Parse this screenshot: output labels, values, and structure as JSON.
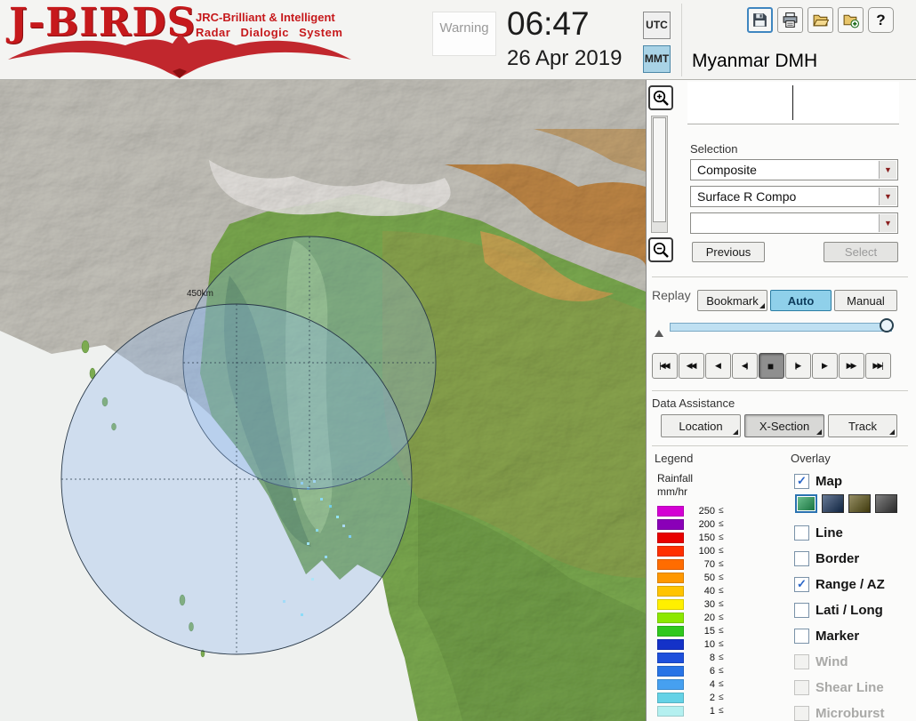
{
  "header": {
    "logo": {
      "title": "J-BIRDS",
      "subtitle_line1": "JRC-Brilliant & Intelligent",
      "subtitle_line2": "Radar Dialogic System"
    },
    "warning_label": "Warning",
    "clock": {
      "time": "06:47",
      "date": "26 Apr 2019"
    },
    "timezone": {
      "utc_label": "UTC",
      "mmt_label": "MMT",
      "selected": "MMT"
    },
    "toolbar_icons": [
      "save-icon",
      "print-icon",
      "open-folder-icon",
      "import-icon",
      "help-icon"
    ],
    "help_glyph": "?",
    "station_title": "Myanmar DMH"
  },
  "map": {
    "range_ring_label": "450km"
  },
  "selection": {
    "label": "Selection",
    "dropdown1_value": "Composite",
    "dropdown2_value": "Surface R Compo",
    "dropdown3_value": "",
    "previous_label": "Previous",
    "select_label": "Select"
  },
  "replay": {
    "label": "Replay",
    "bookmark_label": "Bookmark",
    "auto_label": "Auto",
    "manual_label": "Manual",
    "mode_selected": "Auto",
    "transport_buttons": [
      "|◀◀",
      "◀◀",
      "◀",
      "◀|",
      "■",
      "|▶",
      "▶",
      "▶▶",
      "▶▶|"
    ],
    "transport_active": "■"
  },
  "data_assistance": {
    "label": "Data Assistance",
    "location_label": "Location",
    "xsection_label": "X-Section",
    "track_label": "Track",
    "active": "X-Section"
  },
  "legend": {
    "title": "Legend",
    "unit_line1": "Rainfall",
    "unit_line2": "mm/hr",
    "le_symbol": "≤",
    "rows": [
      {
        "value": "250",
        "color": "#d400d4"
      },
      {
        "value": "200",
        "color": "#8a00b8"
      },
      {
        "value": "150",
        "color": "#e80000"
      },
      {
        "value": "100",
        "color": "#ff3000"
      },
      {
        "value": "70",
        "color": "#ff6c00"
      },
      {
        "value": "50",
        "color": "#ff9800"
      },
      {
        "value": "40",
        "color": "#ffc400"
      },
      {
        "value": "30",
        "color": "#fff000"
      },
      {
        "value": "20",
        "color": "#8ce800"
      },
      {
        "value": "15",
        "color": "#30c81e"
      },
      {
        "value": "10",
        "color": "#1432c8"
      },
      {
        "value": "8",
        "color": "#1e50dc"
      },
      {
        "value": "6",
        "color": "#2874e6"
      },
      {
        "value": "4",
        "color": "#46a0f0"
      },
      {
        "value": "2",
        "color": "#64d2e6"
      },
      {
        "value": "1",
        "color": "#b4f0f0"
      }
    ]
  },
  "overlay": {
    "title": "Overlay",
    "check_glyph": "✓",
    "items": [
      {
        "label": "Map",
        "checked": true,
        "disabled": false
      },
      {
        "label": "Line",
        "checked": false,
        "disabled": false
      },
      {
        "label": "Border",
        "checked": false,
        "disabled": false
      },
      {
        "label": "Range / AZ",
        "checked": true,
        "disabled": false
      },
      {
        "label": "Lati / Long",
        "checked": false,
        "disabled": false
      },
      {
        "label": "Marker",
        "checked": false,
        "disabled": false
      },
      {
        "label": "Wind",
        "checked": false,
        "disabled": true
      },
      {
        "label": "Shear Line",
        "checked": false,
        "disabled": true
      },
      {
        "label": "Microburst",
        "checked": false,
        "disabled": true
      }
    ],
    "map_styles": [
      "#1fa055",
      "#16325c",
      "#5c5212",
      "#3c3c3c"
    ],
    "map_style_selected": 0
  }
}
